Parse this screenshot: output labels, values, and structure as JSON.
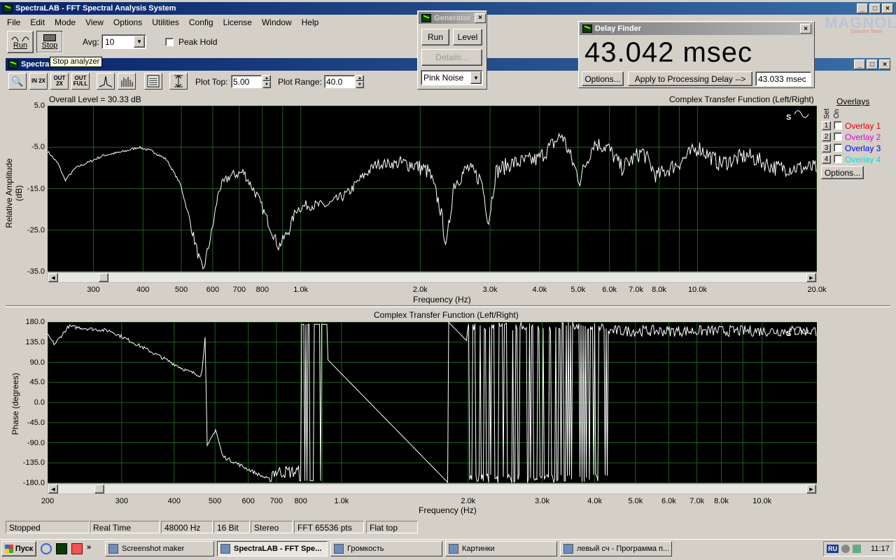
{
  "app": {
    "title": "SpectraLAB - FFT Spectral Analysis System"
  },
  "menu": [
    "File",
    "Edit",
    "Mode",
    "View",
    "Options",
    "Utilities",
    "Config",
    "License",
    "Window",
    "Help"
  ],
  "toolbar": {
    "run_label": "Run",
    "stop_label": "Stop",
    "avg_label": "Avg:",
    "avg_value": "10",
    "peak_hold_label": "Peak Hold",
    "tooltip": "Stop analyzer"
  },
  "inner_window": {
    "title": "SpectraLAB",
    "plot_top_label": "Plot Top:",
    "plot_top_value": "5.00",
    "plot_range_label": "Plot Range:",
    "plot_range_value": "40.0",
    "zoom_in_label": "IN 2X",
    "zoom_out_label": "OUT 2X",
    "zoom_full_label": "OUT FULL"
  },
  "generator": {
    "title": "Generator",
    "run_label": "Run",
    "level_label": "Level",
    "details_label": "Details...",
    "noise_value": "Pink Noise"
  },
  "delay_finder": {
    "title": "Delay Finder",
    "value": "43.042 msec",
    "options_label": "Options...",
    "apply_label": "Apply to Processing Delay -->",
    "delay_value": "43.033 msec"
  },
  "watermark": {
    "text": "MAGNOLIA",
    "sub": "Genuine Team"
  },
  "amplitude_plot": {
    "overall": "Overall Level = 30.33 dB",
    "title": "Complex Transfer Function (Left/Right)",
    "ylabel": "Relative Amplitude (dB)",
    "xlabel": "Frequency (Hz)",
    "yticks": [
      "5.0",
      "-5.0",
      "-15.0",
      "-25.0",
      "-35.0"
    ],
    "xticks": [
      "300",
      "400",
      "500",
      "600",
      "700",
      "800",
      "1.0k",
      "2.0k",
      "3.0k",
      "4.0k",
      "5.0k",
      "6.0k",
      "7.0k",
      "8.0k",
      "10.0k",
      "20.0k"
    ]
  },
  "phase_plot": {
    "title": "Complex Transfer Function (Left/Right)",
    "ylabel": "Phase (degrees)",
    "xlabel": "Frequency (Hz)",
    "yticks": [
      "180.0",
      "135.0",
      "90.0",
      "45.0",
      "0.0",
      "-45.0",
      "-90.0",
      "-135.0",
      "-180.0"
    ],
    "xticks": [
      "200",
      "300",
      "400",
      "500",
      "600",
      "700",
      "800",
      "1.0k",
      "2.0k",
      "3.0k",
      "4.0k",
      "5.0k",
      "6.0k",
      "7.0k",
      "8.0k",
      "10.0k"
    ]
  },
  "overlays": {
    "header": "Overlays",
    "set_label": "Set",
    "on_label": "On",
    "items": [
      {
        "num": "1",
        "label": "Overlay 1"
      },
      {
        "num": "2",
        "label": "Overlay 2"
      },
      {
        "num": "3",
        "label": "Overlay 3"
      },
      {
        "num": "4",
        "label": "Overlay 4"
      }
    ],
    "options_label": "Options..."
  },
  "status": [
    "Stopped",
    "Real Time",
    "48000 Hz",
    "16 Bit",
    "Stereo",
    "FFT 65536 pts",
    "Flat top"
  ],
  "taskbar": {
    "start_label": "Пуск",
    "tasks": [
      "Screenshot maker",
      "SpectraLAB - FFT Spe...",
      "Громкость",
      "Картинки",
      "левый сч - Программа п..."
    ],
    "clock": "11:17",
    "lang": "RU"
  },
  "colors": {
    "titlebar": "#0a246a",
    "plot_bg": "#000000",
    "grid": "#1f5f1f",
    "trace": "#ffffff"
  }
}
